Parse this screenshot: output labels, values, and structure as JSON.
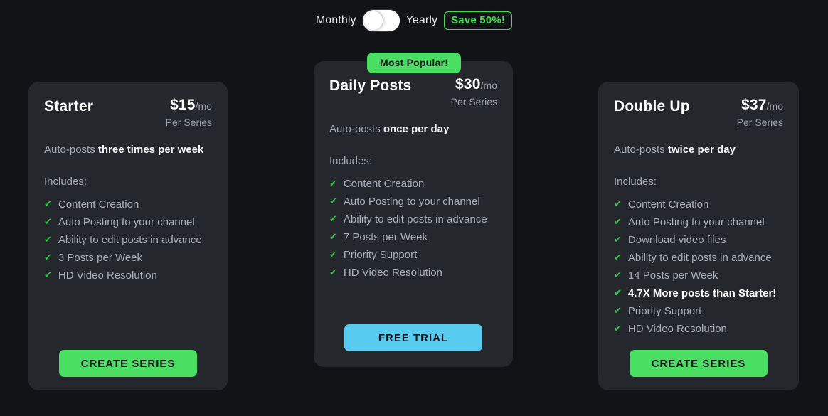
{
  "billing": {
    "monthly_label": "Monthly",
    "yearly_label": "Yearly",
    "save_badge": "Save 50%!",
    "selected": "Monthly",
    "colors": {
      "accent_green": "#4ade62",
      "accent_blue": "#57ccf0",
      "badge_border": "#3ee04a",
      "card_bg": "#24272c",
      "page_bg": "#111317"
    }
  },
  "plans": [
    {
      "name": "Starter",
      "price_amount": "$15",
      "price_period": "/mo",
      "price_sub": "Per Series",
      "tagline_prefix": "Auto-posts ",
      "tagline_strong": "three times per week",
      "includes_label": "Includes:",
      "features": [
        {
          "text": "Content Creation",
          "highlight": false
        },
        {
          "text": "Auto Posting to your channel",
          "highlight": false
        },
        {
          "text": "Ability to edit posts in advance",
          "highlight": false
        },
        {
          "text": "3 Posts per Week",
          "highlight": false
        },
        {
          "text": "HD Video Resolution",
          "highlight": false
        }
      ],
      "cta_label": "CREATE SERIES",
      "cta_style": "green",
      "badge": null
    },
    {
      "name": "Daily Posts",
      "price_amount": "$30",
      "price_period": "/mo",
      "price_sub": "Per Series",
      "tagline_prefix": "Auto-posts ",
      "tagline_strong": "once per day",
      "includes_label": "Includes:",
      "features": [
        {
          "text": "Content Creation",
          "highlight": false
        },
        {
          "text": "Auto Posting to your channel",
          "highlight": false
        },
        {
          "text": "Ability to edit posts in advance",
          "highlight": false
        },
        {
          "text": "7 Posts per Week",
          "highlight": false
        },
        {
          "text": "Priority Support",
          "highlight": false
        },
        {
          "text": "HD Video Resolution",
          "highlight": false
        }
      ],
      "cta_label": "FREE TRIAL",
      "cta_style": "blue",
      "badge": "Most Popular!"
    },
    {
      "name": "Double Up",
      "price_amount": "$37",
      "price_period": "/mo",
      "price_sub": "Per Series",
      "tagline_prefix": "Auto-posts ",
      "tagline_strong": "twice per day",
      "includes_label": "Includes:",
      "features": [
        {
          "text": "Content Creation",
          "highlight": false
        },
        {
          "text": "Auto Posting to your channel",
          "highlight": false
        },
        {
          "text": "Download video files",
          "highlight": false
        },
        {
          "text": "Ability to edit posts in advance",
          "highlight": false
        },
        {
          "text": "14 Posts per Week",
          "highlight": false
        },
        {
          "text": "4.7X More posts than Starter!",
          "highlight": true
        },
        {
          "text": "Priority Support",
          "highlight": false
        },
        {
          "text": "HD Video Resolution",
          "highlight": false
        }
      ],
      "cta_label": "CREATE SERIES",
      "cta_style": "green",
      "badge": null
    }
  ],
  "icons": {
    "check": "✔"
  }
}
